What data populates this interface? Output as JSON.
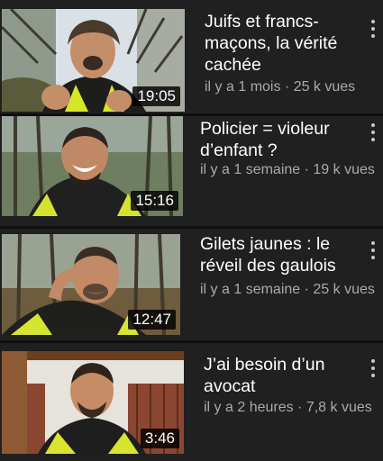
{
  "colors": {
    "background": "#202020",
    "title": "#ffffff",
    "meta": "#aaaaaa",
    "duration_badge": "#000000"
  },
  "videos": [
    {
      "title": "Juifs et francs-\nmaçons, la vérité\ncachée",
      "duration": "19:05",
      "meta": "il y a 1 mois · 25 k vues",
      "thumbnail": "man-with-fur-hat-outdoors",
      "menu_icon": "more-vert-icon"
    },
    {
      "title": "Policier = violeur\nd’enfant ?",
      "duration": "15:16",
      "meta": "il y a 1 semaine · 19 k vues",
      "thumbnail": "smiling-man-yellow-vest-forest",
      "menu_icon": "more-vert-icon"
    },
    {
      "title": "Gilets jaunes : le\nréveil des gaulois",
      "duration": "12:47",
      "meta": "il y a 1 semaine · 25 k vues",
      "thumbnail": "man-pointing-temple-forest",
      "menu_icon": "more-vert-icon"
    },
    {
      "title": "J’ai besoin d’un\navocat",
      "duration": "3:46",
      "meta": "il y a 2 heures · 7,8 k vues",
      "thumbnail": "man-indoors-yellow-vest",
      "menu_icon": "more-vert-icon"
    }
  ]
}
